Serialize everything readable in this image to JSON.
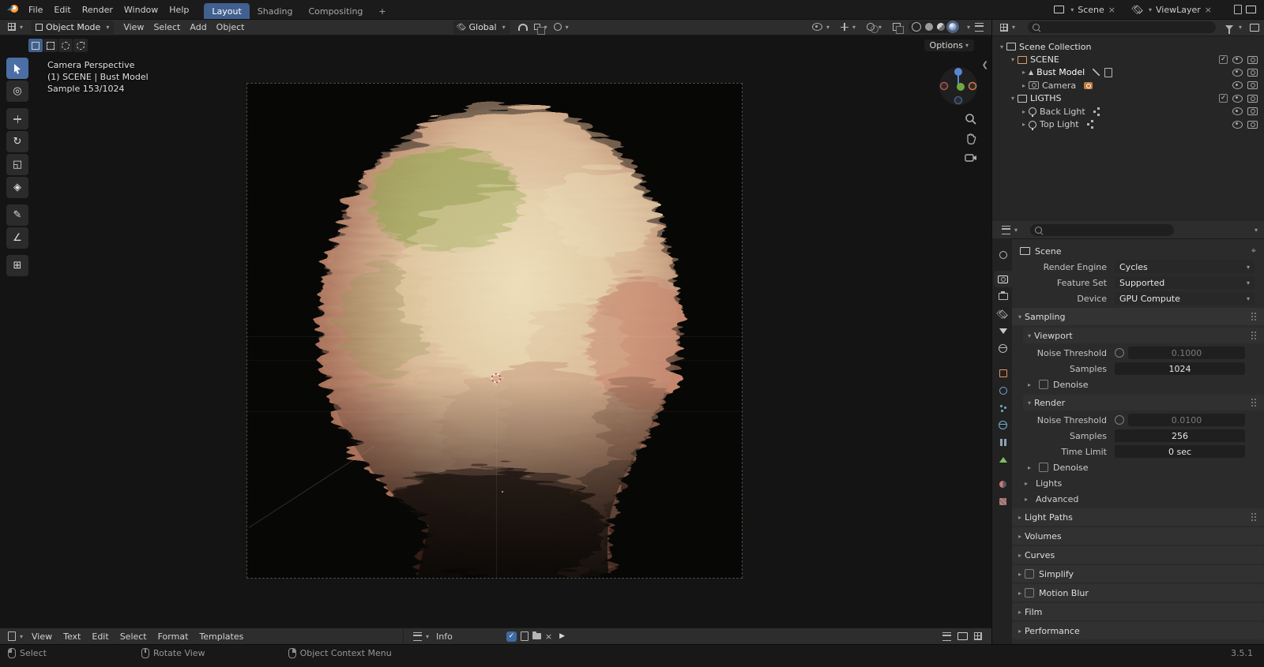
{
  "colors": {
    "accent_blue": "#4772b3",
    "workspace_active": "#41608f",
    "collection_orange": "#c07a3f"
  },
  "icon_names": [
    "blender-logo",
    "chevron-down-icon",
    "editor-type-icon",
    "search-icon",
    "filter-funnel-icon",
    "magnet-icon",
    "proportional-edit-icon",
    "visibility-icon",
    "gizmo-icon",
    "overlays-icon",
    "xray-icon",
    "wireframe-shading-icon",
    "solid-shading-icon",
    "material-shading-icon",
    "rendered-shading-icon",
    "menu-lines-icon",
    "collection-icon",
    "mesh-icon",
    "camera-icon",
    "light-icon",
    "nodetree-icon",
    "modifier-icon",
    "eye-icon",
    "render-visibility-icon",
    "checkbox-icon",
    "nav-gizmo",
    "zoom-icon",
    "pan-hand-icon",
    "camera-view-icon",
    "3d-cursor-icon",
    "grip-dots-icon",
    "mouse-left-icon",
    "mouse-middle-icon",
    "mouse-right-icon",
    "play-icon",
    "folder-icon",
    "close-icon",
    "check-badge-icon"
  ],
  "topbar": {
    "menus": [
      "File",
      "Edit",
      "Render",
      "Window",
      "Help"
    ],
    "workspaces": [
      "Layout",
      "Shading",
      "Compositing"
    ],
    "add_workspace_label": "+",
    "scene_label": "Scene",
    "viewlayer_label": "ViewLayer"
  },
  "viewport_header": {
    "mode_label": "Object Mode",
    "menus": [
      "View",
      "Select",
      "Add",
      "Object"
    ],
    "orientation_label": "Global"
  },
  "viewport": {
    "overlay_line1": "Camera Perspective",
    "overlay_line2": "(1) SCENE | Bust Model",
    "overlay_line3": "Sample 153/1024",
    "options_label": "Options"
  },
  "outliner": {
    "rows": [
      {
        "label": "Scene Collection"
      },
      {
        "label": "SCENE"
      },
      {
        "label": "Bust Model"
      },
      {
        "label": "Camera"
      },
      {
        "label": "LIGTHS"
      },
      {
        "label": "Back Light"
      },
      {
        "label": "Top Light"
      }
    ]
  },
  "properties": {
    "breadcrumb": "Scene",
    "fields": [
      {
        "label": "Render Engine",
        "value": "Cycles"
      },
      {
        "label": "Feature Set",
        "value": "Supported"
      },
      {
        "label": "Device",
        "value": "GPU Compute"
      }
    ],
    "sampling": {
      "title": "Sampling",
      "viewport_title": "Viewport",
      "vp_noise_label": "Noise Threshold",
      "vp_noise_value": "0.1000",
      "vp_samples_label": "Samples",
      "vp_samples_value": "1024",
      "vp_denoise_label": "Denoise",
      "render_title": "Render",
      "r_noise_label": "Noise Threshold",
      "r_noise_value": "0.0100",
      "r_samples_label": "Samples",
      "r_samples_value": "256",
      "r_time_label": "Time Limit",
      "r_time_value": "0 sec",
      "r_denoise_label": "Denoise",
      "lights_label": "Lights",
      "advanced_label": "Advanced"
    },
    "sections": [
      {
        "label": "Light Paths"
      },
      {
        "label": "Volumes"
      },
      {
        "label": "Curves"
      },
      {
        "label": "Simplify"
      },
      {
        "label": "Motion Blur"
      },
      {
        "label": "Film"
      },
      {
        "label": "Performance"
      }
    ]
  },
  "text_editor": {
    "menus": [
      "View",
      "Text",
      "Edit",
      "Select",
      "Format",
      "Templates"
    ]
  },
  "info_editor": {
    "label": "Info"
  },
  "statusbar": {
    "select": "Select",
    "rotate": "Rotate View",
    "context_menu": "Object Context Menu",
    "version": "3.5.1"
  }
}
